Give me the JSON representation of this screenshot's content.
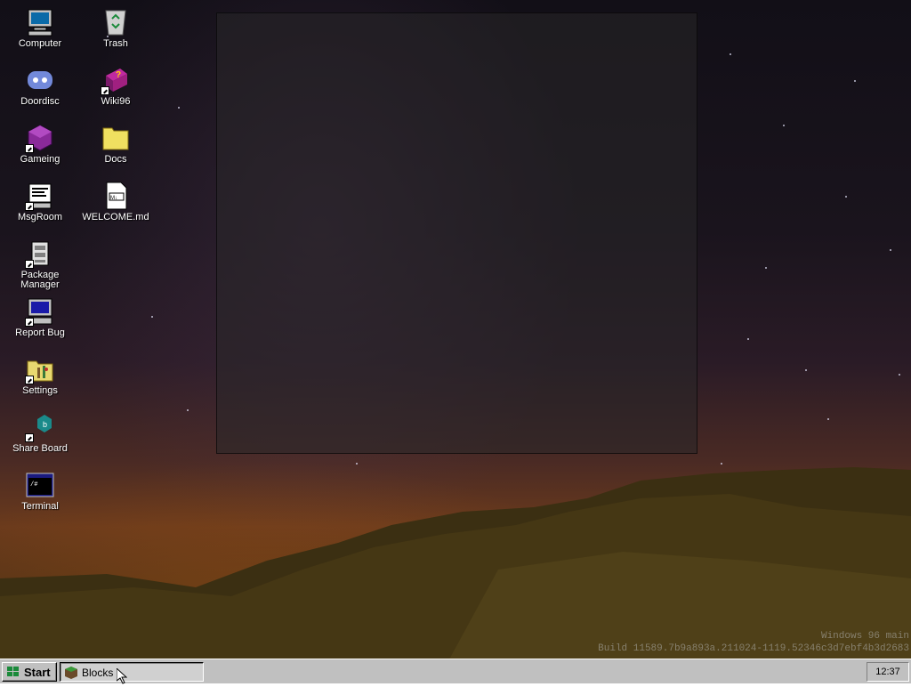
{
  "desktop": {
    "icons": [
      {
        "label": "Computer",
        "icon": "computer-icon"
      },
      {
        "label": "Doordisc",
        "icon": "discord-icon"
      },
      {
        "label": "Gameing",
        "icon": "cube-icon"
      },
      {
        "label": "MsgRoom",
        "icon": "chat-icon"
      },
      {
        "label": "Package Manager",
        "icon": "package-icon"
      },
      {
        "label": "Report Bug",
        "icon": "computer-icon"
      },
      {
        "label": "Settings",
        "icon": "settings-folder-icon"
      },
      {
        "label": "Share Board",
        "icon": "share-icon"
      },
      {
        "label": "Terminal",
        "icon": "terminal-icon"
      },
      {
        "label": "Trash",
        "icon": "recycle-bin-icon"
      },
      {
        "label": "Wiki96",
        "icon": "help-book-icon"
      },
      {
        "label": "Docs",
        "icon": "folder-icon"
      },
      {
        "label": "WELCOME.md",
        "icon": "markdown-file-icon"
      }
    ]
  },
  "build": {
    "line1": "Windows 96 main",
    "line2": "Build 11589.7b9a893a.211024-1119.52346c3d7ebf4b3d2683"
  },
  "taskbar": {
    "start_label": "Start",
    "tasks": [
      {
        "label": "Blocks",
        "icon": "blocks-icon"
      }
    ],
    "clock": "12:37"
  },
  "colors": {
    "taskbar": "#c0c0c0",
    "overlay": "#2a282a"
  }
}
